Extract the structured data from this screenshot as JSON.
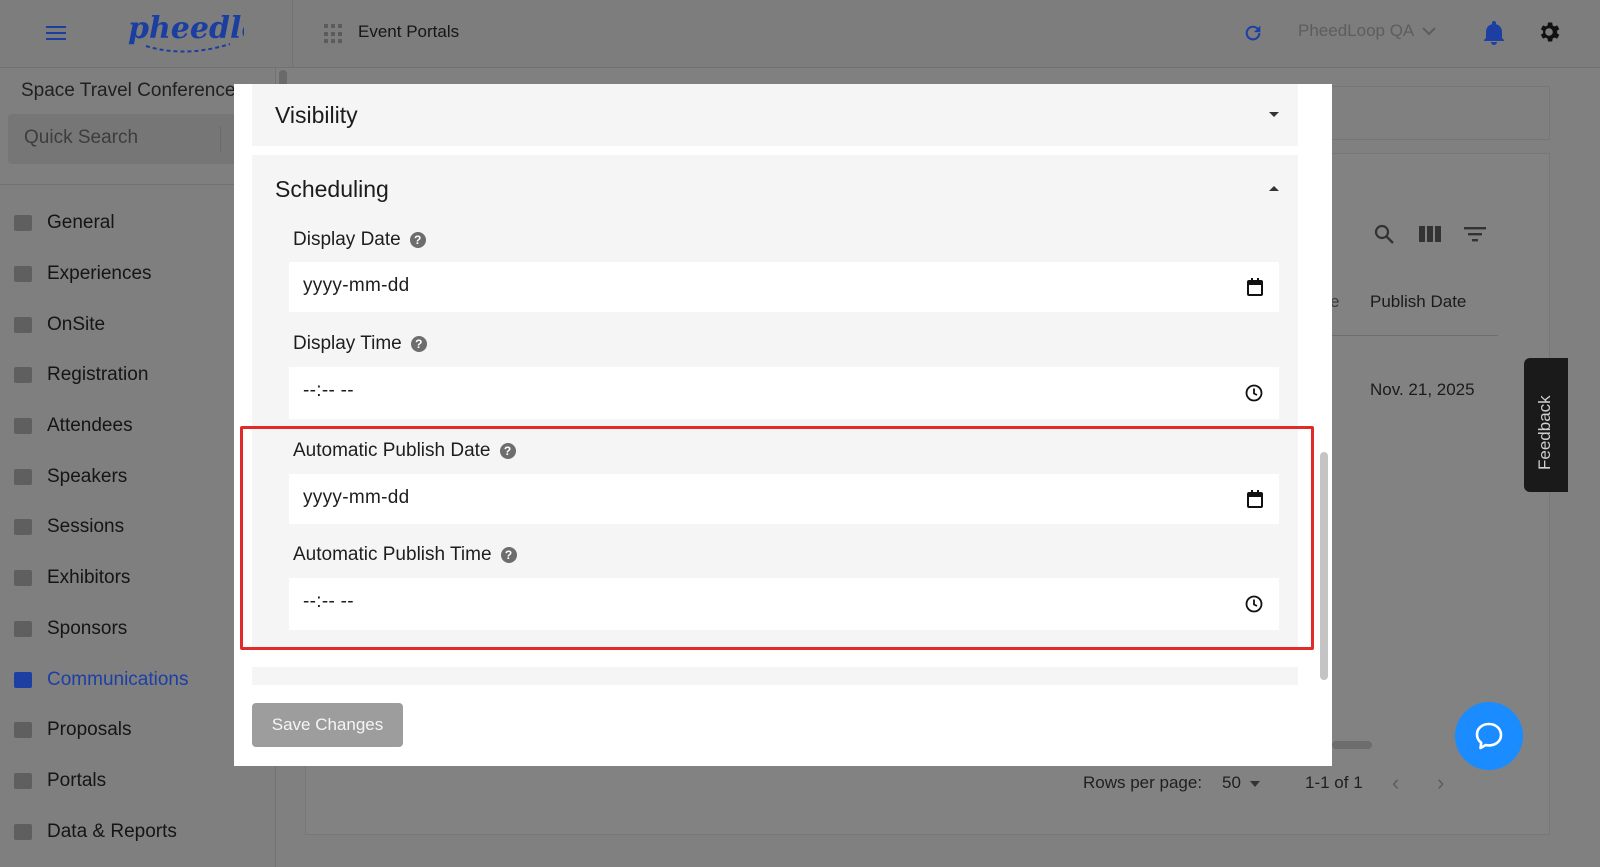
{
  "header": {
    "logo_text": "pheedloop",
    "section_title": "Event Portals",
    "org_name": "PheedLoop QA"
  },
  "sidebar": {
    "event_name": "Space Travel Conference",
    "search_placeholder": "Quick Search",
    "items": [
      {
        "label": "General",
        "icon": "grid-icon"
      },
      {
        "label": "Experiences",
        "icon": "person-icon"
      },
      {
        "label": "OnSite",
        "icon": "printer-icon"
      },
      {
        "label": "Registration",
        "icon": "cart-icon"
      },
      {
        "label": "Attendees",
        "icon": "people-icon"
      },
      {
        "label": "Speakers",
        "icon": "presenter-icon"
      },
      {
        "label": "Sessions",
        "icon": "laptop-icon"
      },
      {
        "label": "Exhibitors",
        "icon": "store-icon"
      },
      {
        "label": "Sponsors",
        "icon": "badge-icon"
      },
      {
        "label": "Communications",
        "icon": "mail-icon",
        "active": true
      },
      {
        "label": "Proposals",
        "icon": "document-icon"
      },
      {
        "label": "Portals",
        "icon": "globe-icon"
      },
      {
        "label": "Data & Reports",
        "icon": "chart-icon"
      }
    ]
  },
  "table": {
    "column_header": "Publish Date",
    "column_header_truncated": "e",
    "rows": [
      {
        "publish_date": "Nov. 21, 2025"
      }
    ],
    "rows_per_page_label": "Rows per page:",
    "rows_per_page_value": "50",
    "range_label": "1-1 of 1"
  },
  "feedback_label": "Feedback",
  "modal": {
    "visibility_title": "Visibility",
    "scheduling_title": "Scheduling",
    "display_date_label": "Display Date",
    "display_date_value": "yyyy-mm-dd",
    "display_time_label": "Display Time",
    "display_time_value": "--:-- --",
    "auto_publish_date_label": "Automatic Publish Date",
    "auto_publish_date_value": "yyyy-mm-dd",
    "auto_publish_time_label": "Automatic Publish Time",
    "auto_publish_time_value": "--:-- --",
    "save_label": "Save Changes",
    "help_glyph": "?"
  },
  "colors": {
    "accent": "#1d3fa4",
    "highlight": "#e12a2a",
    "chat": "#1a8cff"
  }
}
